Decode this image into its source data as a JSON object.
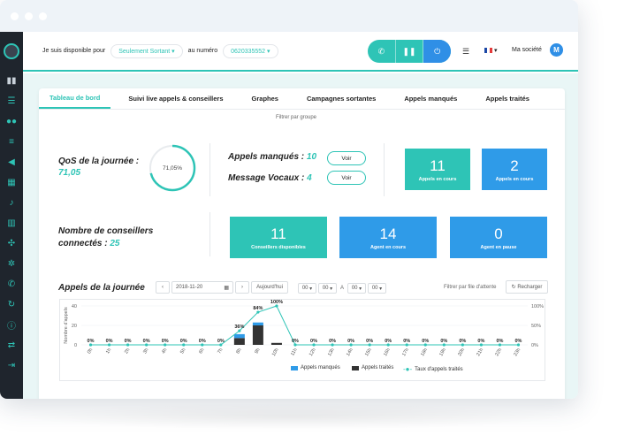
{
  "topbar": {
    "available_text": "Je suis disponible pour",
    "mode_value": "Seulement Sortant",
    "number_text": "au numéro",
    "number_value": "0620335552",
    "company": "Ma société",
    "avatar_letter": "M",
    "call_buttons": [
      "phone-icon",
      "pause-icon",
      "power-icon"
    ],
    "accent": "#2ec4b6",
    "accent_blue": "#2f8fe6"
  },
  "tabs": [
    {
      "label": "Tableau de bord",
      "active": true
    },
    {
      "label": "Suivi live appels & conseillers"
    },
    {
      "label": "Graphes"
    },
    {
      "label": "Campagnes sortantes"
    },
    {
      "label": "Appels manqués"
    },
    {
      "label": "Appels traités"
    }
  ],
  "filter_group": "Filtrer par groupe",
  "qos": {
    "label": "QoS de la journée :",
    "value": "71,05",
    "gauge_text": "71,05%",
    "percent": 71.05
  },
  "missed_calls": {
    "label": "Appels manqués :",
    "value": "10",
    "button": "Voir"
  },
  "voice_messages": {
    "label": "Message Vocaux :",
    "value": "4",
    "button": "Voir"
  },
  "tiles": {
    "calls_in_progress_teal": {
      "value": "11",
      "label": "Appels en cours"
    },
    "calls_in_progress_blue": {
      "value": "2",
      "label": "Appels en cours"
    },
    "advisors_available": {
      "value": "11",
      "label": "Conseillers disponibles"
    },
    "agents_busy": {
      "value": "14",
      "label": "Agent en cours"
    },
    "agents_paused": {
      "value": "0",
      "label": "Agent en pause"
    }
  },
  "advisors": {
    "label_line1": "Nombre de conseillers",
    "label_line2": "connectés :",
    "value": "25"
  },
  "calls_today": {
    "title": "Appels de la journée",
    "date": "2018-11-20",
    "today_button": "Aujourd'hui",
    "time_from_h": "00",
    "time_from_m": "00",
    "time_sep": "A",
    "time_to_h": "00",
    "time_to_m": "00",
    "queue_filter": "Filtrer par file d'attente",
    "reload": "Recharger"
  },
  "chart_data": {
    "type": "bar",
    "categories": [
      "0h",
      "1h",
      "2h",
      "3h",
      "4h",
      "5h",
      "6h",
      "7h",
      "8h",
      "9h",
      "10h",
      "11h",
      "12h",
      "13h",
      "14h",
      "15h",
      "16h",
      "17h",
      "18h",
      "19h",
      "20h",
      "21h",
      "22h",
      "23h"
    ],
    "ylabel": "Nombre d'appels",
    "ylim": [
      0,
      40
    ],
    "yticks": [
      0,
      20,
      40
    ],
    "y2lim": [
      0,
      100
    ],
    "y2ticks": [
      "0%",
      "50%",
      "100%"
    ],
    "series": [
      {
        "name": "Appels manqués",
        "color": "#2f9be8",
        "values": [
          0,
          0,
          0,
          0,
          0,
          0,
          0,
          0,
          4,
          3,
          0,
          0,
          0,
          0,
          0,
          0,
          0,
          0,
          0,
          0,
          0,
          0,
          0,
          0
        ]
      },
      {
        "name": "Appels traités",
        "color": "#333333",
        "values": [
          0,
          0,
          0,
          0,
          0,
          0,
          0,
          0,
          7,
          20,
          2,
          0,
          0,
          0,
          0,
          0,
          0,
          0,
          0,
          0,
          0,
          0,
          0,
          0
        ]
      },
      {
        "name": "Taux d'appels traités",
        "color": "#2ec4b6",
        "type": "line",
        "values": [
          0,
          0,
          0,
          0,
          0,
          0,
          0,
          0,
          36,
          84,
          100,
          0,
          0,
          0,
          0,
          0,
          0,
          0,
          0,
          0,
          0,
          0,
          0,
          0
        ]
      }
    ],
    "data_labels": [
      "0%",
      "0%",
      "0%",
      "0%",
      "0%",
      "0%",
      "0%",
      "0%",
      "36%",
      "84%",
      "100%",
      "0%",
      "0%",
      "0%",
      "0%",
      "0%",
      "0%",
      "0%",
      "0%",
      "0%",
      "0%",
      "0%",
      "0%",
      "0%"
    ],
    "legend": "bottom"
  }
}
